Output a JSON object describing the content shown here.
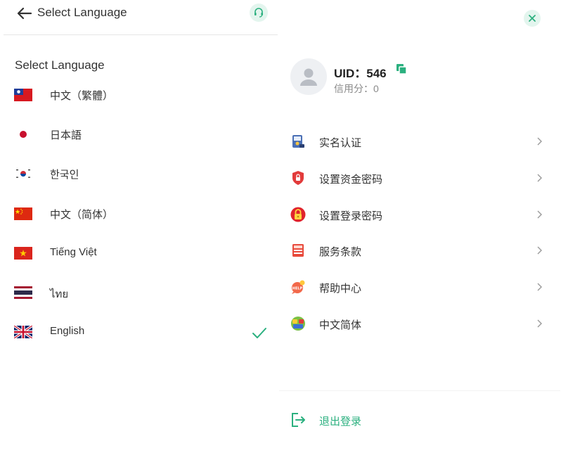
{
  "left_panel": {
    "header_title": "Select Language",
    "section_title": "Select Language",
    "languages": [
      {
        "label": "中文（繁體）",
        "flag": "taiwan-flag-icon"
      },
      {
        "label": "日本語",
        "flag": "japan-flag-icon"
      },
      {
        "label": "한국인",
        "flag": "korea-flag-icon"
      },
      {
        "label": "中文（简体）",
        "flag": "china-flag-icon"
      },
      {
        "label": "Tiếng Việt",
        "flag": "vietnam-flag-icon"
      },
      {
        "label": "ไทย",
        "flag": "thailand-flag-icon"
      },
      {
        "label": "English",
        "flag": "uk-flag-icon",
        "selected": true
      }
    ]
  },
  "right_panel": {
    "uid_text": "UID：546",
    "credit_text": "信用分：0",
    "menu": [
      {
        "label": "实名认证",
        "icon": "id-card-icon"
      },
      {
        "label": "设置资金密码",
        "icon": "shield-lock-icon"
      },
      {
        "label": "设置登录密码",
        "icon": "padlock-icon"
      },
      {
        "label": "服务条款",
        "icon": "document-icon"
      },
      {
        "label": "帮助中心",
        "icon": "help-chat-icon"
      },
      {
        "label": "中文简体",
        "icon": "language-icon"
      }
    ],
    "logout_label": "退出登录"
  },
  "colors": {
    "accent": "#2bb07f",
    "accent_light": "#e3f5ee",
    "text": "#333333",
    "muted": "#8a8a8a"
  }
}
